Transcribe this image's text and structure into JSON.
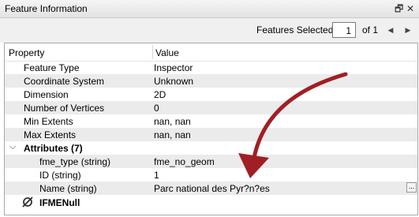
{
  "window": {
    "title": "Feature Information",
    "pin_icon": "pin-icon",
    "close_icon": "close-icon"
  },
  "toolbar": {
    "features_selected_label": "Features Selected:",
    "page_value": "1",
    "of_label": "of 1"
  },
  "table": {
    "headers": {
      "property": "Property",
      "value": "Value"
    },
    "rows": [
      {
        "key": "Feature Type",
        "value": "Inspector"
      },
      {
        "key": "Coordinate System",
        "value": "Unknown"
      },
      {
        "key": "Dimension",
        "value": "2D"
      },
      {
        "key": "Number of Vertices",
        "value": "0"
      },
      {
        "key": "Min Extents",
        "value": "nan, nan"
      },
      {
        "key": "Max Extents",
        "value": "nan, nan"
      }
    ],
    "attributes_group": {
      "label": "Attributes (7)",
      "rows": [
        {
          "key": "fme_type (string)",
          "value": "fme_no_geom"
        },
        {
          "key": "ID (string)",
          "value": "1"
        },
        {
          "key": "Name (string)",
          "value": "Parc national des Pyr?n?es",
          "ellipsis": "..."
        }
      ]
    },
    "geometry_row": {
      "label": "IFMENull"
    }
  },
  "colors": {
    "arrow": "#a01f24",
    "alt_row": "#ebebeb"
  }
}
